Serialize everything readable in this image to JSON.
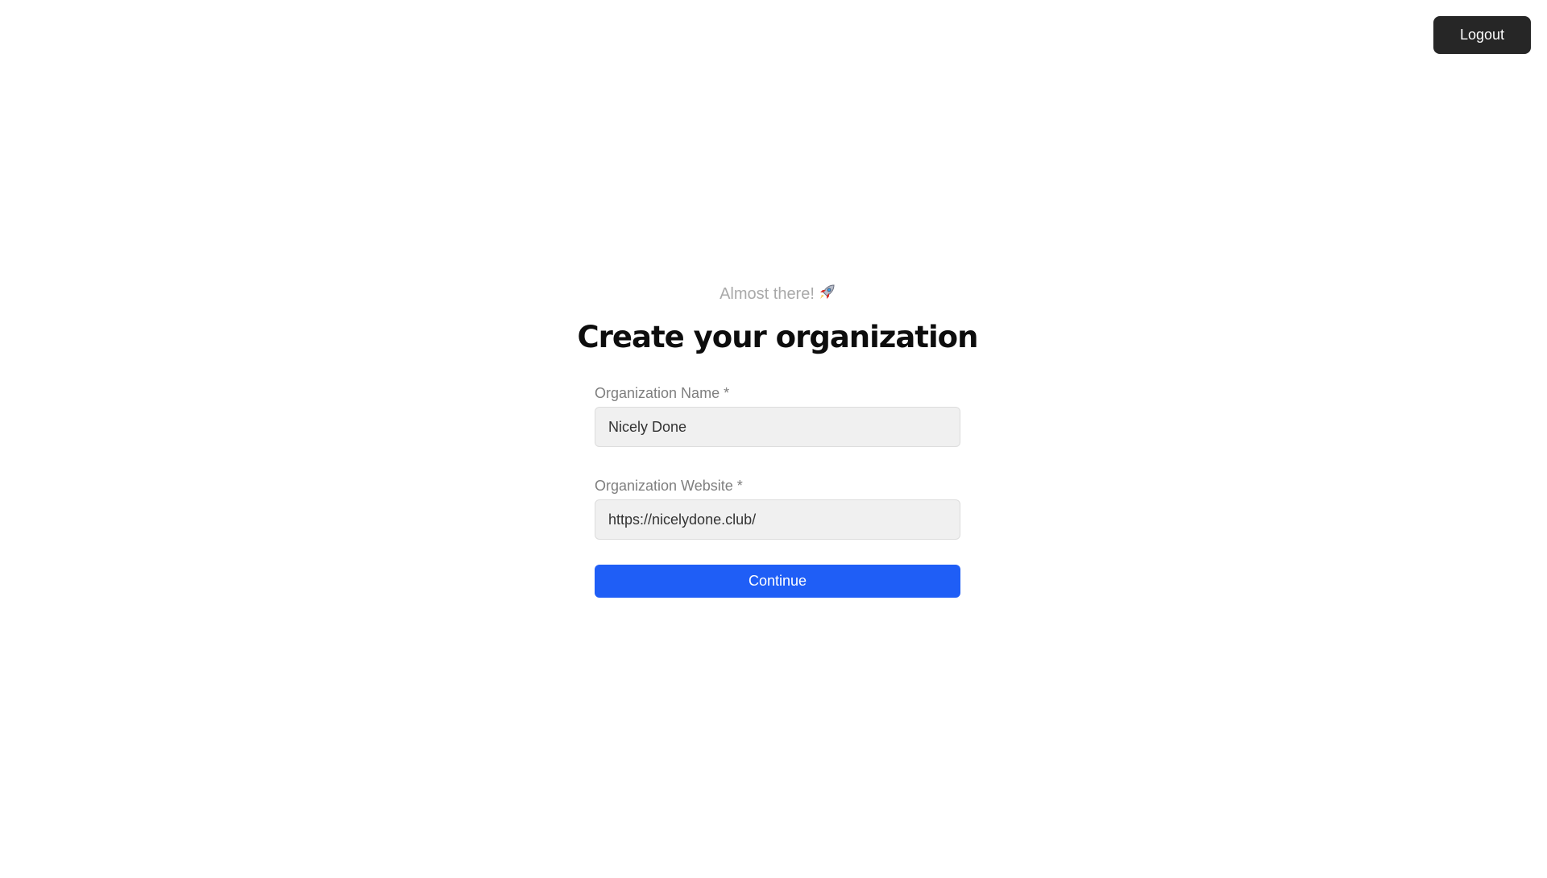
{
  "header": {
    "logout_label": "Logout"
  },
  "form": {
    "eyebrow": "Almost there!",
    "eyebrow_icon": "rocket-icon",
    "title": "Create your organization",
    "fields": [
      {
        "label": "Organization Name *",
        "value": "Nicely Done"
      },
      {
        "label": "Organization Website *",
        "value": "https://nicelydone.club/"
      }
    ],
    "continue_label": "Continue"
  },
  "colors": {
    "primary": "#1f5ef6",
    "logout_bg": "#262626",
    "input_bg": "#f0f0f0"
  }
}
